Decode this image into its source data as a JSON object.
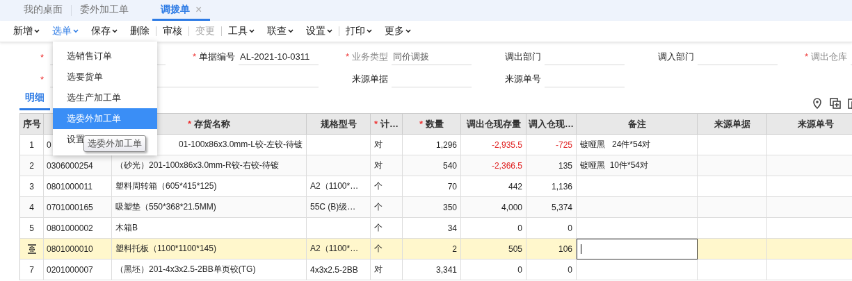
{
  "tabs": [
    {
      "label": "我的桌面",
      "selected": false,
      "closable": false
    },
    {
      "label": "委外加工单",
      "selected": false,
      "closable": false
    },
    {
      "label": "调拨单",
      "selected": true,
      "closable": true,
      "close_glyph": "×"
    }
  ],
  "toolbar": [
    {
      "label": "新增",
      "caret": true,
      "open": false,
      "disabled": false,
      "divider_before": false
    },
    {
      "label": "选单",
      "caret": true,
      "open": true,
      "disabled": false,
      "divider_before": false
    },
    {
      "label": "保存",
      "caret": true,
      "open": false,
      "disabled": false,
      "divider_before": false
    },
    {
      "label": "删除",
      "caret": false,
      "open": false,
      "disabled": false,
      "divider_before": false
    },
    {
      "label": "审核",
      "caret": false,
      "open": false,
      "disabled": false,
      "divider_before": true
    },
    {
      "label": "变更",
      "caret": false,
      "open": false,
      "disabled": true,
      "divider_before": true
    },
    {
      "label": "工具",
      "caret": true,
      "open": false,
      "disabled": false,
      "divider_before": true
    },
    {
      "label": "联查",
      "caret": true,
      "open": false,
      "disabled": false,
      "divider_before": false
    },
    {
      "label": "设置",
      "caret": true,
      "open": false,
      "disabled": false,
      "divider_before": false
    },
    {
      "label": "打印",
      "caret": true,
      "open": false,
      "disabled": false,
      "divider_before": true
    },
    {
      "label": "更多",
      "caret": true,
      "open": false,
      "disabled": false,
      "divider_before": false
    }
  ],
  "dropdown": {
    "items": [
      {
        "label": "选销售订单",
        "selected": false
      },
      {
        "label": "选要货单",
        "selected": false
      },
      {
        "label": "选生产加工单",
        "selected": false
      },
      {
        "label": "选委外加工单",
        "selected": true
      },
      {
        "label": "设置",
        "selected": false
      }
    ],
    "tooltip": "选委外加工单"
  },
  "form_rows": [
    [
      {
        "kind": "field",
        "required_mark": "*"
      },
      {
        "kind": "field",
        "label": "单据编号",
        "required_mark": "*",
        "value": "AL-2021-10-0311"
      },
      {
        "kind": "field",
        "label": "业务类型",
        "required_mark": "*",
        "muted": true,
        "value": "同价调拨"
      },
      {
        "kind": "field",
        "label": "调出部门"
      },
      {
        "kind": "field",
        "label": "调入部门"
      },
      {
        "kind": "field",
        "label": "调出仓库",
        "required_mark": "*",
        "muted": true
      }
    ],
    [
      {
        "kind": "wide",
        "required_mark": "*"
      },
      {
        "kind": "field",
        "label": "来源单据"
      },
      {
        "kind": "field",
        "label": "来源单号"
      }
    ]
  ],
  "detail_tab": {
    "label": "明细",
    "selected": true
  },
  "table": {
    "columns": [
      {
        "label": "序号"
      },
      {},
      {
        "label": "存货名称",
        "required_mark": "*"
      },
      {
        "label": "规格型号"
      },
      {
        "label": "计…",
        "required_mark": "*"
      },
      {
        "label": "数量",
        "required_mark": "*"
      },
      {
        "label": "调出仓现存量"
      },
      {
        "label": "调入仓现…"
      },
      {
        "label": "备注"
      },
      {
        "label": "来源单据"
      },
      {
        "label": "来源单号"
      }
    ],
    "rows": [
      {
        "index": "1",
        "code": "0",
        "name": "01-100x86x3.0mm-L铰-左铰-待镀",
        "name_cut_left": true,
        "unit": "对",
        "qty": "1,296",
        "out_stock": {
          "text": "-2,935.5",
          "alert": true
        },
        "in_stock": {
          "text": "-725",
          "alert": true
        },
        "note": "镀哑黑   24件*54对",
        "selected": false,
        "editing": false
      },
      {
        "index": "2",
        "code": "0306000254",
        "name": "（砂光）201-100x86x3.0mm-R铰-右铰-待镀",
        "name_cut_left": false,
        "unit": "对",
        "qty": "540",
        "out_stock": {
          "text": "-2,366.5",
          "alert": true
        },
        "in_stock": {
          "text": "135",
          "alert": false
        },
        "note": "镀哑黑  10件*54对",
        "selected": false,
        "editing": false
      },
      {
        "index": "3",
        "code": "0801000011",
        "name": "塑料周转箱（605*415*125)",
        "name_cut_left": false,
        "spec": "A2（1100*…",
        "unit": "个",
        "qty": "70",
        "out_stock": {
          "text": "442",
          "alert": false
        },
        "in_stock": {
          "text": "1,136",
          "alert": false
        },
        "selected": false,
        "editing": false
      },
      {
        "index": "4",
        "code": "0701000165",
        "name": "吸塑垫（550*368*21.5MM)",
        "name_cut_left": false,
        "spec": "55C (B)级…",
        "unit": "个",
        "qty": "350",
        "out_stock": {
          "text": "4,000",
          "alert": false
        },
        "in_stock": {
          "text": "5,374",
          "alert": false
        },
        "selected": false,
        "editing": false
      },
      {
        "index": "5",
        "code": "0801000002",
        "name": "木箱B",
        "name_cut_left": false,
        "unit": "个",
        "qty": "34",
        "out_stock": {
          "text": "0",
          "alert": false
        },
        "in_stock": {
          "text": "0",
          "alert": false
        },
        "selected": false,
        "editing": false
      },
      {
        "code": "0801000010",
        "name": "塑料托板（1100*1100*145)",
        "name_cut_left": false,
        "spec": "A2（1100*…",
        "unit": "个",
        "qty": "2",
        "out_stock": {
          "text": "505",
          "alert": false
        },
        "in_stock": {
          "text": "106",
          "alert": false
        },
        "selected": true,
        "editing": true
      },
      {
        "index": "7",
        "code": "0201000007",
        "name": "（黑坯）201-4x3x2.5-2BB单页铰(TG)",
        "name_cut_left": false,
        "spec": "4x3x2.5-2BB",
        "unit": "对",
        "qty": "3,341",
        "out_stock": {
          "text": "0",
          "alert": false
        },
        "in_stock": {
          "text": "0",
          "alert": false
        },
        "selected": false,
        "editing": false
      }
    ]
  }
}
